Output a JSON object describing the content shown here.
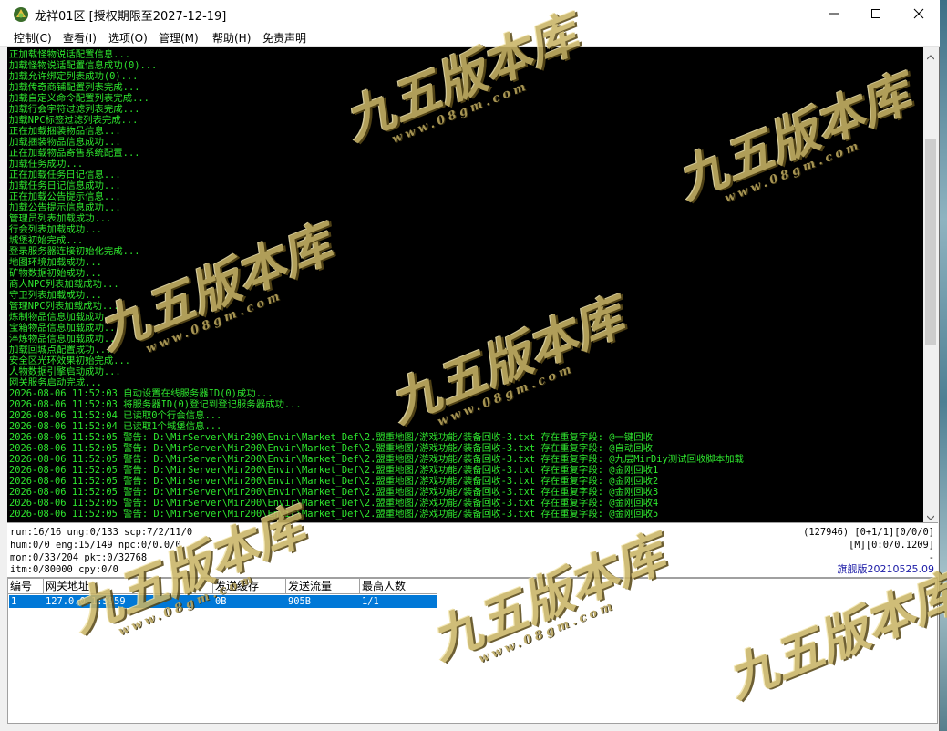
{
  "window": {
    "title": "龙祥01区 [授权期限至2027-12-19]",
    "icon": "app-logo-icon",
    "minimize_icon": "minimize-icon",
    "maximize_icon": "maximize-icon",
    "close_icon": "close-icon"
  },
  "menu": [
    {
      "label": "控制(C)"
    },
    {
      "label": "查看(I)"
    },
    {
      "label": "选项(O)"
    },
    {
      "label": "管理(M)"
    },
    {
      "label": "帮助(H)"
    },
    {
      "label": "免责声明"
    }
  ],
  "console": {
    "text_color": "#2ee62e",
    "background": "#000000",
    "lines": [
      "正加载怪物说话配置信息...",
      "加载怪物说话配置信息成功(0)...",
      "加载允许绑定列表成功(0)...",
      "加载传奇商铺配置列表完成...",
      "加载自定义命令配置列表完成...",
      "加载行会字符过滤列表完成...",
      "加载NPC标签过滤列表完成...",
      "正在加载捆装物品信息...",
      "加载捆装物品信息成功...",
      "正在加载物品寄售系统配置...",
      "加载任务成功...",
      "正在加载任务日记信息...",
      "加载任务日记信息成功...",
      "正在加载公告提示信息...",
      "加载公告提示信息成功...",
      "管理员列表加载成功...",
      "行会列表加载成功...",
      "城堡初始完成...",
      "登录服务器连接初始化完成...",
      "地图环境加载成功...",
      "矿物数据初始成功...",
      "商人NPC列表加载成功...",
      "守卫列表加载成功...",
      "管理NPC列表加载成功...",
      "炼制物品信息加载成功...",
      "宝箱物品信息加载成功...",
      "淬炼物品信息加载成功...",
      "加载回城点配置成功...",
      "安全区光环效果初始完成...",
      "人物数据引擎启动成功...",
      "网关服务启动完成...",
      "2026-08-06 11:52:03 自动设置在线服务器ID(0)成功...",
      "2026-08-06 11:52:03 将服务器ID(0)登记到登记服务器成功...",
      "2026-08-06 11:52:04 已读取0个行会信息...",
      "2026-08-06 11:52:04 已读取1个城堡信息...",
      "2026-08-06 11:52:05 警告: D:\\MirServer\\Mir200\\Envir\\Market_Def\\2.盟重地图/游戏功能/装备回收-3.txt 存在重复字段: @一键回收",
      "2026-08-06 11:52:05 警告: D:\\MirServer\\Mir200\\Envir\\Market_Def\\2.盟重地图/游戏功能/装备回收-3.txt 存在重复字段: @自动回收",
      "2026-08-06 11:52:05 警告: D:\\MirServer\\Mir200\\Envir\\Market_Def\\2.盟重地图/游戏功能/装备回收-3.txt 存在重复字段: @九层MirDiy测试回收脚本加载",
      "2026-08-06 11:52:05 警告: D:\\MirServer\\Mir200\\Envir\\Market_Def\\2.盟重地图/游戏功能/装备回收-3.txt 存在重复字段: @金刚回收1",
      "2026-08-06 11:52:05 警告: D:\\MirServer\\Mir200\\Envir\\Market_Def\\2.盟重地图/游戏功能/装备回收-3.txt 存在重复字段: @金刚回收2",
      "2026-08-06 11:52:05 警告: D:\\MirServer\\Mir200\\Envir\\Market_Def\\2.盟重地图/游戏功能/装备回收-3.txt 存在重复字段: @金刚回收3",
      "2026-08-06 11:52:05 警告: D:\\MirServer\\Mir200\\Envir\\Market_Def\\2.盟重地图/游戏功能/装备回收-3.txt 存在重复字段: @金刚回收4",
      "2026-08-06 11:52:05 警告: D:\\MirServer\\Mir200\\Envir\\Market_Def\\2.盟重地图/游戏功能/装备回收-3.txt 存在重复字段: @金刚回收5"
    ]
  },
  "status": {
    "run": "run:16/16 ung:0/133 scp:7/2/11/0",
    "hum": "hum:0/0 eng:15/149 npc:0/0.0/0",
    "mon": "mon:0/33/204 pkt:0/32768",
    "itm": "itm:0/80000 cpy:0/0",
    "right1": "(127946) [0+1/1][0/0/0]",
    "right2": "[M][0:0/0.1209]",
    "right3": "-",
    "edition": "旗舰版20210525.09"
  },
  "gateway_table": {
    "columns": [
      "编号",
      "网关地址",
      "发送缓存",
      "发送流量",
      "最高人数"
    ],
    "rows": [
      [
        "1",
        "127.0.0.1:5959",
        "0B",
        "905B",
        "1/1"
      ]
    ],
    "selected_color": "#0078d7"
  },
  "watermark": {
    "text": "九五版本库",
    "url": "www.08gm.com"
  }
}
